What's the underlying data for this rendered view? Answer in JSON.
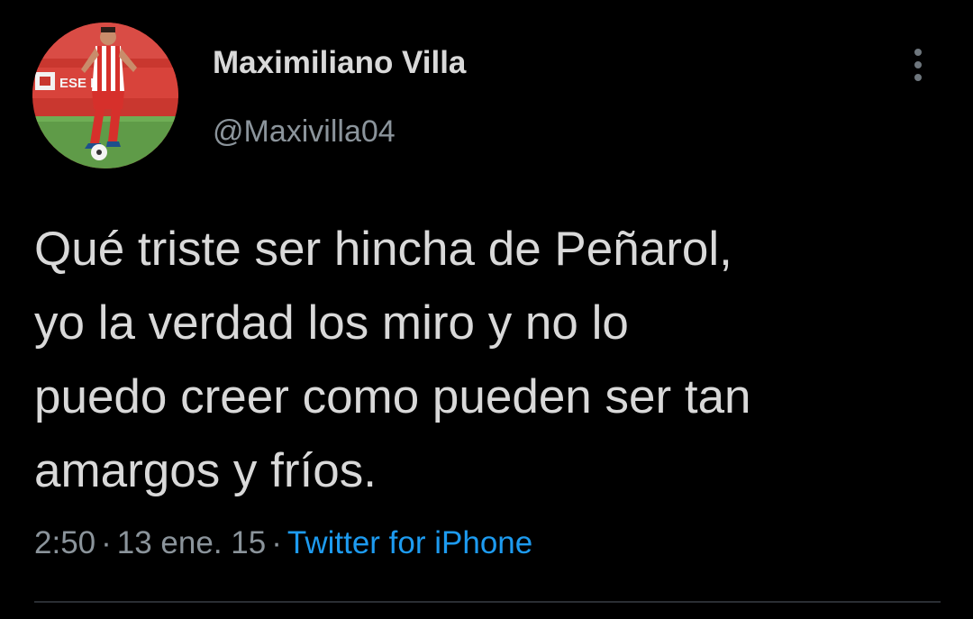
{
  "author": {
    "display_name": "Maximiliano Villa",
    "handle": "@Maxivilla04",
    "avatar_icon": "player-photo-avatar",
    "avatar_banner_text": "ESE ER"
  },
  "tweet": {
    "text_lines": [
      "Qué triste ser hincha de Peñarol,",
      "yo la verdad los miro y no lo",
      "puedo creer como pueden ser tan",
      "amargos y fríos."
    ],
    "time": "2:50",
    "date": "13 ene. 15",
    "separator": "·",
    "source": "Twitter for iPhone"
  },
  "menu": {
    "icon": "vertical-dots-icon"
  },
  "colors": {
    "background": "#000000",
    "text_primary": "#d9d9d9",
    "text_secondary": "#8b949b",
    "link": "#1d9bf0",
    "divider": "#2a2e33"
  }
}
